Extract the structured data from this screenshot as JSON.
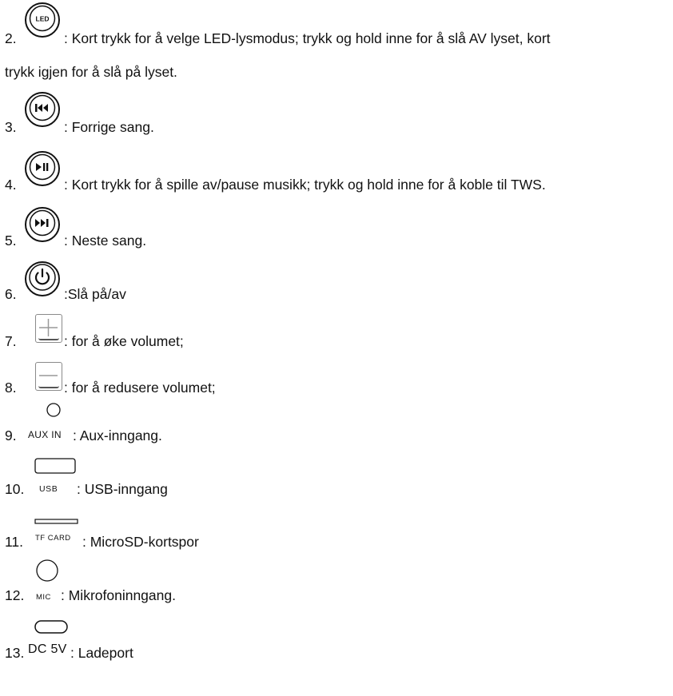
{
  "items": [
    {
      "num": "2.",
      "icon": "led-button-icon",
      "icon_label": "LED",
      "line1": ": Kort trykk for å velge LED-lysmodus; trykk og hold inne for å slå AV lyset, kort",
      "line2": "trykk igjen for å slå på lyset."
    },
    {
      "num": "3.",
      "icon": "previous-track-icon",
      "text": ": Forrige sang."
    },
    {
      "num": "4.",
      "icon": "play-pause-icon",
      "text": ": Kort trykk for å spille av/pause musikk; trykk og hold inne for å koble til TWS."
    },
    {
      "num": "5.",
      "icon": "next-track-icon",
      "text": ": Neste sang."
    },
    {
      "num": "6.",
      "icon": "power-icon",
      "text": ":Slå på/av"
    },
    {
      "num": "7.",
      "icon": "plus-button-icon",
      "text": ": for å øke volumet;"
    },
    {
      "num": "8.",
      "icon": "minus-button-icon",
      "text": ": for å redusere volumet;"
    },
    {
      "num": "9.",
      "icon": "aux-port-icon",
      "port_label": "AUX IN",
      "text": ": Aux-inngang."
    },
    {
      "num": "10.",
      "icon": "usb-port-icon",
      "port_label": "USB",
      "text": ": USB-inngang"
    },
    {
      "num": "11.",
      "icon": "tf-card-slot-icon",
      "port_label": "TF CARD",
      "text": ": MicroSD-kortspor"
    },
    {
      "num": "12.",
      "icon": "mic-port-icon",
      "port_label": "MIC",
      "text": ": Mikrofoninngang."
    },
    {
      "num": "13.",
      "icon": "dc-port-icon",
      "port_label": "DC 5V",
      "text": ": Ladeport"
    }
  ]
}
